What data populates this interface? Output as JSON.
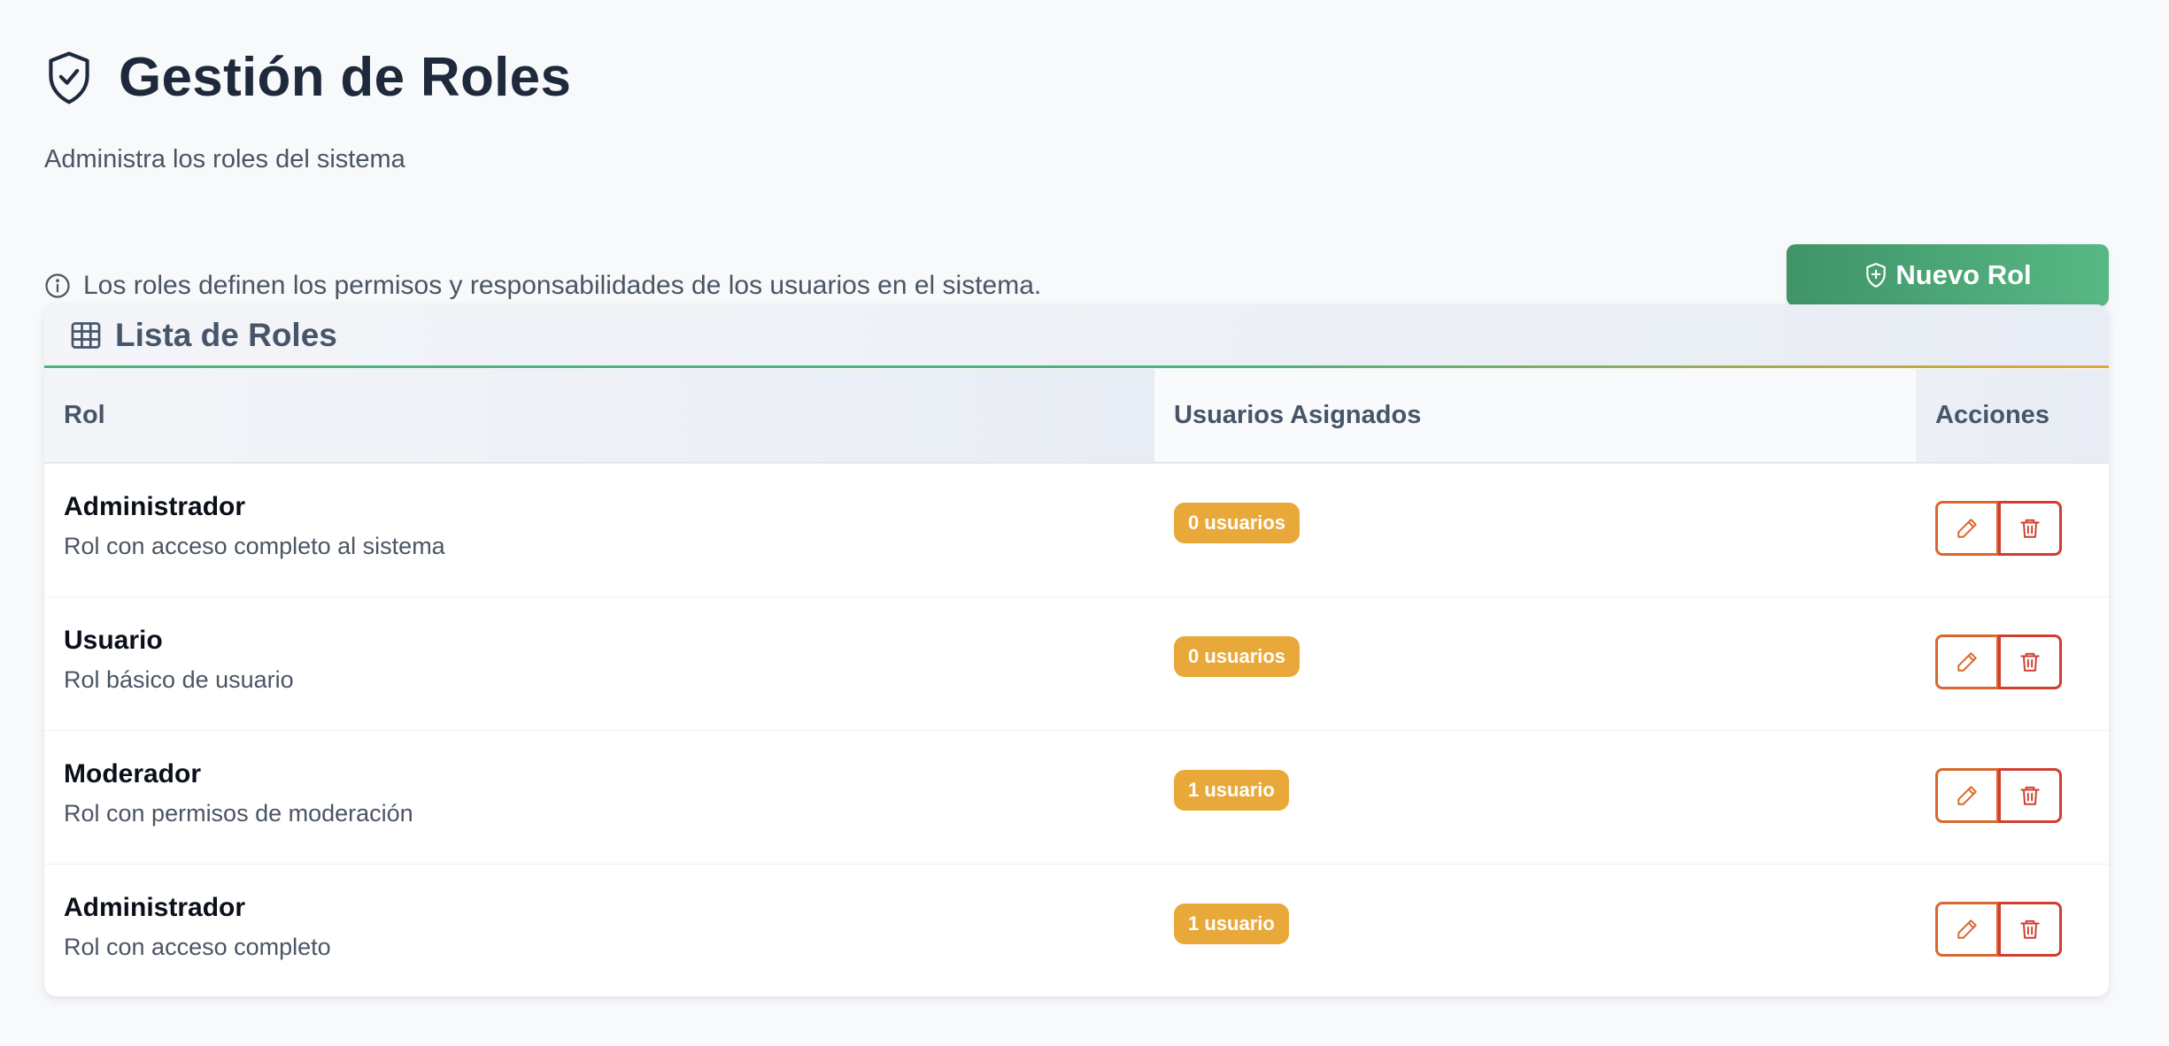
{
  "header": {
    "title": "Gestión de Roles",
    "subtitle": "Administra los roles del sistema",
    "icon": "shield-check-icon"
  },
  "info": {
    "text": "Los roles definen los permisos y responsabilidades de los usuarios en el sistema.",
    "icon": "info-circle-icon"
  },
  "actions": {
    "new_role_label": "Nuevo Rol",
    "new_role_icon": "shield-plus-icon"
  },
  "card": {
    "title": "Lista de Roles",
    "icon": "table-icon"
  },
  "table": {
    "columns": [
      "Rol",
      "Usuarios Asignados",
      "Acciones"
    ],
    "rows": [
      {
        "name": "Administrador",
        "description": "Rol con acceso completo al sistema",
        "users": "0 usuarios"
      },
      {
        "name": "Usuario",
        "description": "Rol básico de usuario",
        "users": "0 usuarios"
      },
      {
        "name": "Moderador",
        "description": "Rol con permisos de moderación",
        "users": "1 usuario"
      },
      {
        "name": "Administrador",
        "description": "Rol con acceso completo",
        "users": "1 usuario"
      }
    ],
    "row_actions": [
      "pencil-icon",
      "trash-icon"
    ]
  },
  "colors": {
    "primary_green": "#4fb27c",
    "badge_amber": "#e8a93a",
    "edit_orange": "#d9682e",
    "delete_red": "#cf3e30",
    "heading": "#1e293b"
  }
}
